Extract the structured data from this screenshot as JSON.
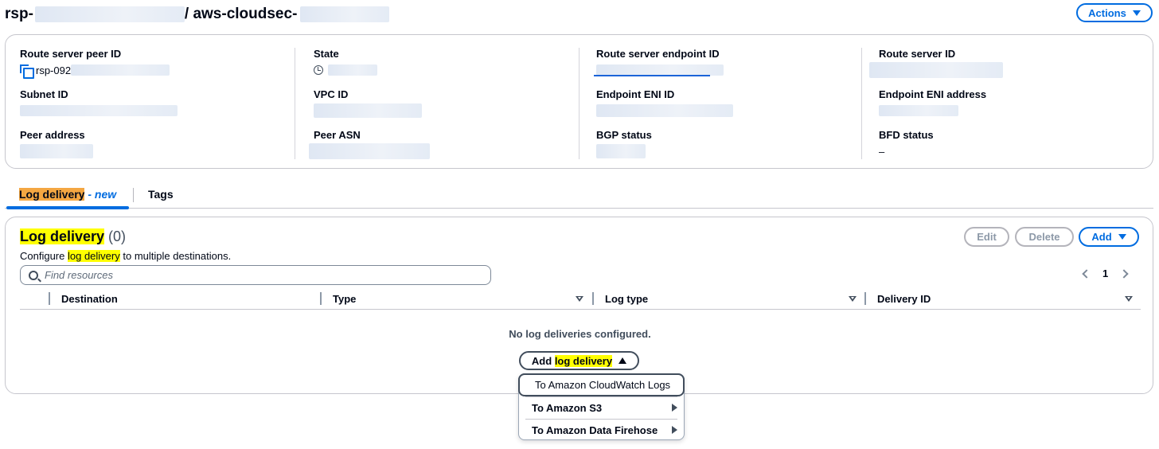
{
  "header": {
    "title_prefix": "rsp-",
    "title_slash": "/ aws-cloudsec-",
    "actions_label": "Actions"
  },
  "details": {
    "route_server_peer_id": {
      "label": "Route server peer ID",
      "value": "rsp-092"
    },
    "state": {
      "label": "State"
    },
    "route_server_endpoint_id": {
      "label": "Route server endpoint ID"
    },
    "route_server_id": {
      "label": "Route server ID"
    },
    "subnet_id": {
      "label": "Subnet ID"
    },
    "vpc_id": {
      "label": "VPC ID"
    },
    "endpoint_eni_id": {
      "label": "Endpoint ENI ID"
    },
    "endpoint_eni_address": {
      "label": "Endpoint ENI address"
    },
    "peer_address": {
      "label": "Peer address"
    },
    "peer_asn": {
      "label": "Peer ASN"
    },
    "bgp_status": {
      "label": "BGP status"
    },
    "bfd_status": {
      "label": "BFD status",
      "value": "–"
    }
  },
  "tabs": {
    "log_delivery_label": "Log delivery",
    "log_delivery_suffix": "- new",
    "tags_label": "Tags"
  },
  "log_delivery": {
    "title": "Log delivery",
    "count": "(0)",
    "desc_prefix": "Configure ",
    "desc_highlight": "log delivery",
    "desc_suffix": " to multiple destinations.",
    "edit_label": "Edit",
    "delete_label": "Delete",
    "add_label": "Add",
    "search_placeholder": "Find resources",
    "page_number": "1",
    "columns": [
      "Destination",
      "Type",
      "Log type",
      "Delivery ID"
    ],
    "empty_message": "No log deliveries configured.",
    "add_log_prefix": "Add ",
    "add_log_highlight": "log delivery"
  },
  "dropdown": {
    "items": [
      {
        "label": "To Amazon CloudWatch Logs"
      },
      {
        "label": "To Amazon S3"
      },
      {
        "label": "To Amazon Data Firehose"
      }
    ]
  },
  "colors": {
    "accent": "#006ce0",
    "highlight": "#ffff00",
    "highlight_orange": "#f4a742",
    "border": "#c6c6cd"
  }
}
